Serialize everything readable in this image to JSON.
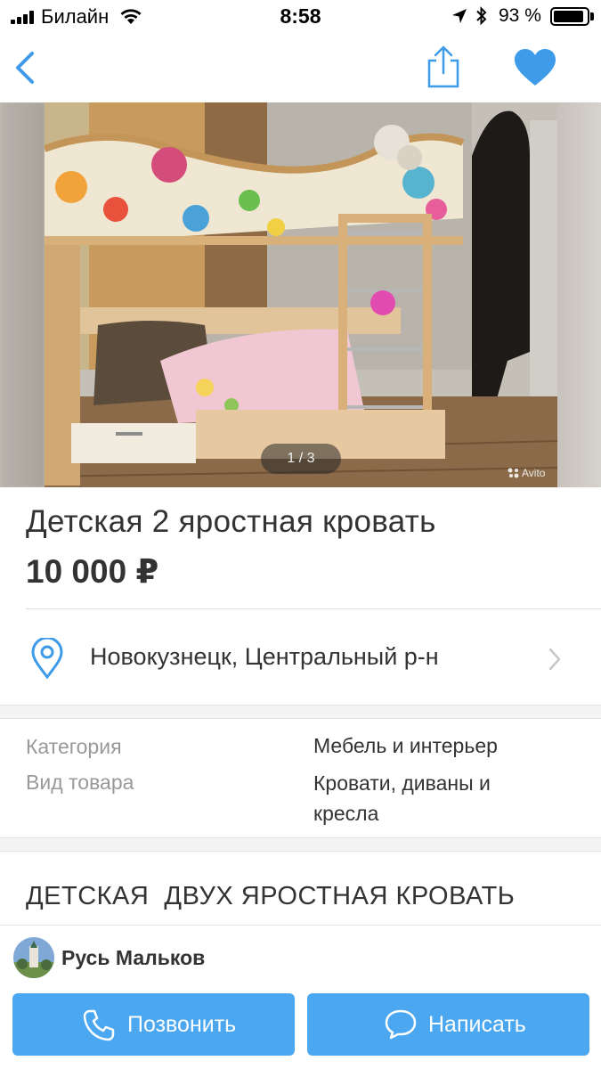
{
  "status_bar": {
    "carrier": "Билайн",
    "time": "8:58",
    "battery_percent_text": "93 %",
    "battery_level": 0.93
  },
  "nav": {
    "back_icon": "chevron-left-icon",
    "share_icon": "share-icon",
    "favorite_icon": "heart-icon",
    "accent_color": "#3d9be9"
  },
  "gallery": {
    "counter": "1 / 3",
    "watermark": "Avito",
    "current": 1,
    "total": 3
  },
  "listing": {
    "title": "Детская 2 яростная кровать",
    "price": "10 000 ₽"
  },
  "location": {
    "text": "Новокузнецк, Центральный р-н",
    "icon": "map-pin-icon"
  },
  "params": [
    {
      "key": "Категория",
      "value": "Мебель и интерьер"
    },
    {
      "key": "Вид товара",
      "value": "Кровати, диваны и кресла"
    }
  ],
  "description": "ДЕТСКАЯ  ДВУХ ЯРОСТНАЯ КРОВАТЬ",
  "seller": {
    "name": "Русь Мальков"
  },
  "actions": {
    "call_label": "Позвонить",
    "message_label": "Написать",
    "button_color": "#4aa7f0"
  }
}
